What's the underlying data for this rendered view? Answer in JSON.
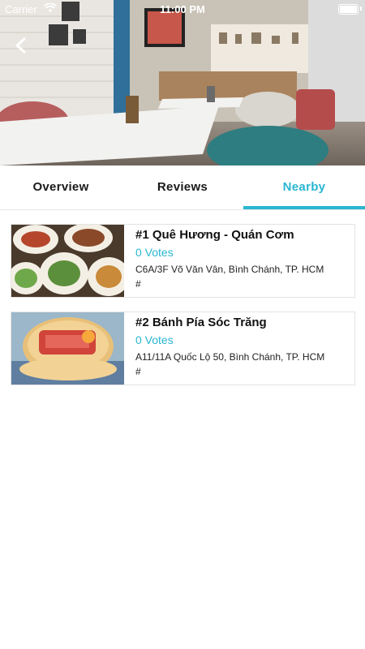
{
  "status_bar": {
    "carrier": "Carrier",
    "time": "11:00 PM"
  },
  "hero": {
    "description_icon": "cafe-interior-photo"
  },
  "tabs": [
    {
      "label": "Overview",
      "active": false
    },
    {
      "label": "Reviews",
      "active": false
    },
    {
      "label": "Nearby",
      "active": true
    }
  ],
  "nearby": [
    {
      "rank_title": "#1 Quê Hương - Quán Cơm",
      "votes": "0 Votes",
      "address": "C6A/3F Võ Văn Vân, Bình Chánh, TP. HCM",
      "link": "#",
      "thumb_icon": "rice-dishes-photo"
    },
    {
      "rank_title": "#2 Bánh Pía Sóc Trăng",
      "votes": "0 Votes",
      "address": "A11/11A Quốc Lộ 50, Bình Chánh, TP. HCM",
      "link": "#",
      "thumb_icon": "mooncake-photo"
    }
  ],
  "colors": {
    "accent": "#29b6d1",
    "text": "#111111",
    "divider": "#e3e3e3"
  }
}
